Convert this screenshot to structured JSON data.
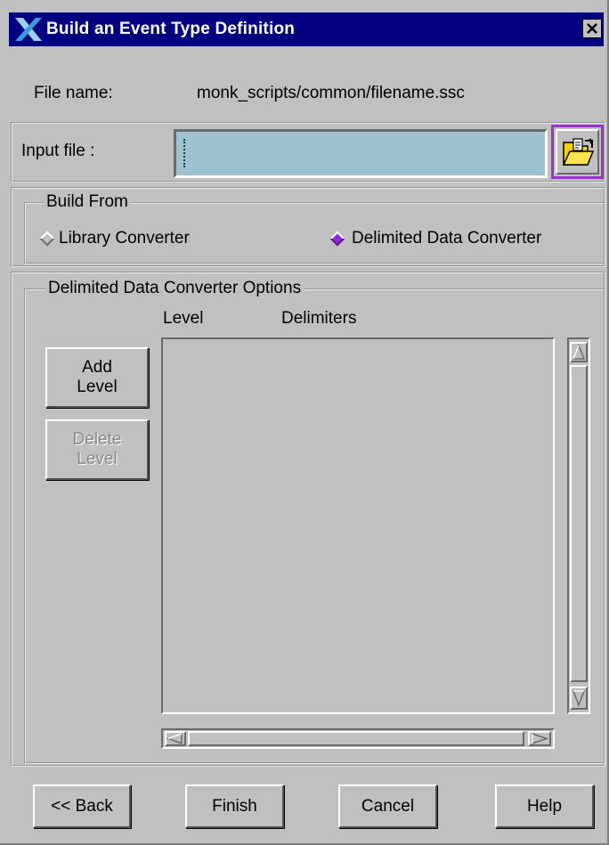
{
  "window": {
    "title": "Build an Event Type Definition",
    "close_icon": "close-x-icon",
    "app_icon": "x-logo-icon"
  },
  "file_name": {
    "label": "File name:",
    "value": "monk_scripts/common/filename.ssc"
  },
  "input_file": {
    "label": "Input file :",
    "value": "",
    "browse_icon": "folder-open-icon",
    "field_color": "#9dc3cf",
    "highlight_color": "#9b30d9"
  },
  "build_from": {
    "legend": "Build From",
    "options": [
      {
        "label": "Library Converter",
        "selected": false
      },
      {
        "label": "Delimited Data Converter",
        "selected": true
      }
    ],
    "selected_color": "#8a2be2"
  },
  "options_group": {
    "legend": "Delimited Data Converter Options",
    "columns": [
      "Level",
      "Delimiters"
    ],
    "add_level_line1": "Add",
    "add_level_line2": "Level",
    "delete_level_line1": "Delete",
    "delete_level_line2": "Level",
    "rows": []
  },
  "footer": {
    "back": "<< Back",
    "finish": "Finish",
    "cancel": "Cancel",
    "help": "Help"
  }
}
